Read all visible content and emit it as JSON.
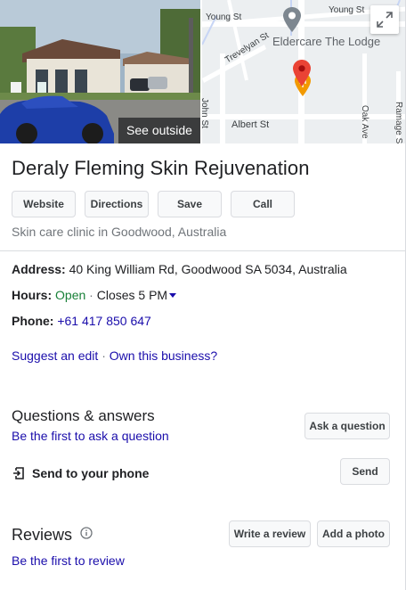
{
  "media": {
    "see_outside": "See outside",
    "map_labels": {
      "young_st_1": "Young St",
      "young_st_2": "Young St",
      "trevelyan_st": "Trevelyan St",
      "john_st": "John St",
      "albert_st": "Albert St",
      "oak_ave": "Oak Ave",
      "ramage_st": "Ramage S",
      "poi": "Eldercare The Lodge"
    }
  },
  "business": {
    "name": "Deraly Fleming Skin Rejuvenation",
    "category": "Skin care clinic in Goodwood, Australia"
  },
  "actions": {
    "website": "Website",
    "directions": "Directions",
    "save": "Save",
    "call": "Call"
  },
  "details": {
    "address_label": "Address:",
    "address_value": "40 King William Rd, Goodwood SA 5034, Australia",
    "hours_label": "Hours:",
    "hours_status": "Open",
    "hours_separator": "·",
    "hours_closes": "Closes 5 PM",
    "phone_label": "Phone:",
    "phone_value": "+61 417 850 647"
  },
  "links": {
    "suggest_edit": "Suggest an edit",
    "separator": "·",
    "own_business": "Own this business?"
  },
  "qa": {
    "title": "Questions & answers",
    "first_to_ask": "Be the first to ask a question",
    "ask_button": "Ask a question"
  },
  "send": {
    "label": "Send to your phone",
    "button": "Send"
  },
  "reviews": {
    "title": "Reviews",
    "first_to_review": "Be the first to review",
    "write_button": "Write a review",
    "photo_button": "Add a photo"
  },
  "colors": {
    "link": "#1a0dab",
    "open": "#188038",
    "map_pin": "#ea4335",
    "poi_pin": "#f9ab00"
  }
}
